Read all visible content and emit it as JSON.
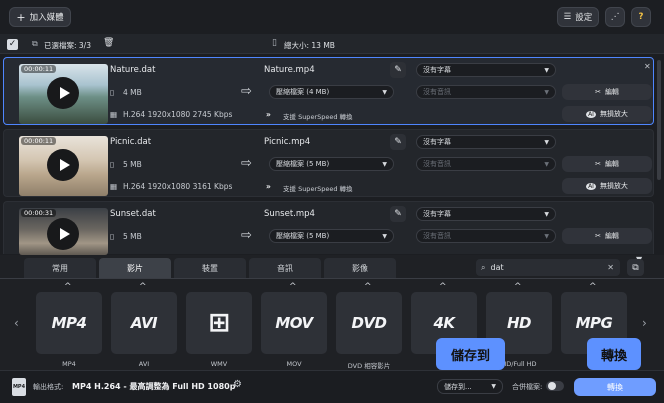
{
  "toolbar": {
    "add_media": "加入媒體",
    "settings": "設定"
  },
  "selection": {
    "selected": "已選檔案: 3/3",
    "total": "總大小: 13 MB"
  },
  "files": [
    {
      "duration": "00:00:11",
      "src_name": "Nature.dat",
      "src_size": "4 MB",
      "src_codec": "H.264 1920x1080 2745 Kbps",
      "out_name": "Nature.mp4",
      "out_size": "壓縮檔案 (4 MB)",
      "superspeed": "支援 SuperSpeed 轉換",
      "subtitle": "沒有字幕",
      "audio": "沒有音訊",
      "edit": "編輯",
      "ai": "無損放大"
    },
    {
      "duration": "00:00:11",
      "src_name": "Picnic.dat",
      "src_size": "5 MB",
      "src_codec": "H.264 1920x1080 3161 Kbps",
      "out_name": "Picnic.mp4",
      "out_size": "壓縮檔案 (5 MB)",
      "superspeed": "支援 SuperSpeed 轉換",
      "subtitle": "沒有字幕",
      "audio": "沒有音訊",
      "edit": "編輯",
      "ai": "無損放大"
    },
    {
      "duration": "00:00:31",
      "src_name": "Sunset.dat",
      "src_size": "5 MB",
      "src_codec": "",
      "out_name": "Sunset.mp4",
      "out_size": "壓縮檔案 (5 MB)",
      "superspeed": "",
      "subtitle": "沒有字幕",
      "audio": "沒有音訊",
      "edit": "編輯",
      "ai": ""
    }
  ],
  "tabs": [
    "常用",
    "影片",
    "裝置",
    "音訊",
    "影像"
  ],
  "search": {
    "value": "dat"
  },
  "formats": [
    {
      "logo": "MP4",
      "label": "MP4"
    },
    {
      "logo": "AVI",
      "label": "AVI"
    },
    {
      "logo": "⊞",
      "label": "WMV"
    },
    {
      "logo": "MOV",
      "label": "MOV"
    },
    {
      "logo": "DVD",
      "label": "DVD 相容影片"
    },
    {
      "logo": "4K",
      "label": "4K"
    },
    {
      "logo": "HD",
      "label": "HD/Full HD"
    },
    {
      "logo": "MPG",
      "label": "MPG"
    }
  ],
  "footer": {
    "output_label": "輸出格式:",
    "output_value": "MP4 H.264 - 最高調整為 Full HD 1080p",
    "save_to": "儲存到...",
    "merge": "合併檔案:",
    "convert": "轉換"
  },
  "callouts": {
    "save": "儲存到",
    "convert": "轉換"
  },
  "colors": {
    "accent": "#5d91ff",
    "selected_border": "#4f86ff"
  }
}
